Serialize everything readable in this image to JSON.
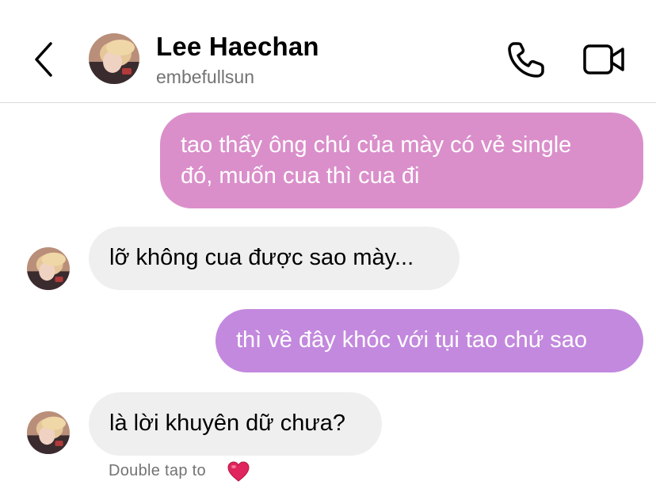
{
  "header": {
    "back_icon": "chevron-left-icon",
    "name": "Lee Haechan",
    "username": "embefullsun",
    "call_icon": "phone-icon",
    "video_icon": "video-camera-icon"
  },
  "messages": [
    {
      "direction": "outgoing",
      "text": "tao thấy ông chú của mày có vẻ single\nđó, muốn cua thì cua đi",
      "color": "#da8fca"
    },
    {
      "direction": "incoming",
      "text": "lỡ không cua được sao mày...",
      "color": "#efefef"
    },
    {
      "direction": "outgoing",
      "text": "thì về đây khóc với tụi tao chứ sao",
      "color": "#c389de"
    },
    {
      "direction": "incoming",
      "text": "là lời khuyên dữ chưa?",
      "color": "#efefef"
    }
  ],
  "reaction_hint": {
    "text": "Double tap to",
    "icon": "red-heart-icon",
    "color": "#e0245e"
  }
}
